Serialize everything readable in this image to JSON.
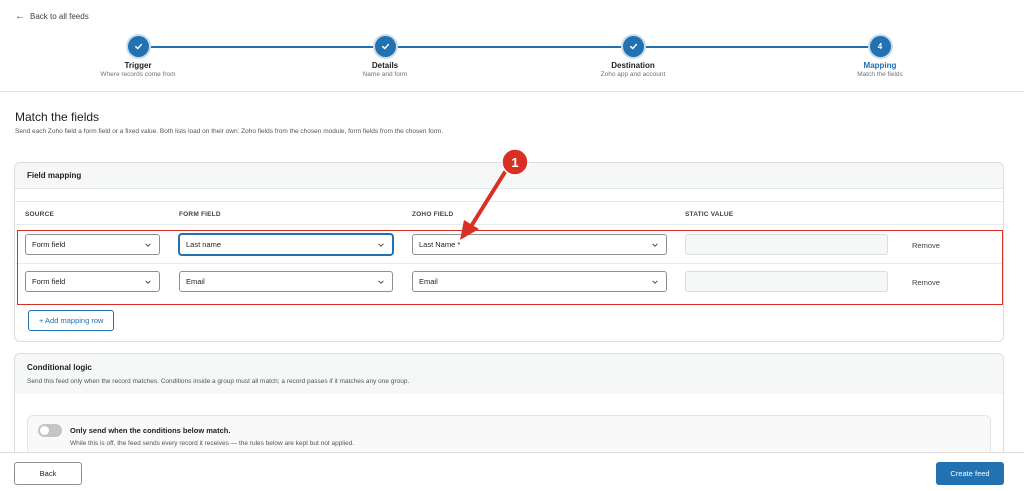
{
  "nav": {
    "back_label": "Back to all feeds"
  },
  "steps": [
    {
      "title": "Trigger",
      "subtitle": "Where records come from",
      "marker": "check"
    },
    {
      "title": "Details",
      "subtitle": "Name and form",
      "marker": "check"
    },
    {
      "title": "Destination",
      "subtitle": "Zoho app and account",
      "marker": "check"
    },
    {
      "title": "Mapping",
      "subtitle": "Match the fields",
      "marker": "4"
    }
  ],
  "page": {
    "title": "Match the fields",
    "description": "Send each Zoho field a form field or a fixed value. Both lists load on their own: Zoho fields from the chosen module, form fields from the chosen form."
  },
  "mapping": {
    "card_title": "Field mapping",
    "columns": {
      "source": "SOURCE",
      "form_field": "FORM FIELD",
      "zoho_field": "ZOHO FIELD",
      "static_value": "STATIC VALUE"
    },
    "rows": [
      {
        "source": "Form field",
        "form_field": "Last name",
        "zoho_field": "Last Name *",
        "static_value": "",
        "remove_label": "Remove"
      },
      {
        "source": "Form field",
        "form_field": "Email",
        "zoho_field": "Email",
        "static_value": "",
        "remove_label": "Remove"
      }
    ],
    "add_row_label": "+ Add mapping row"
  },
  "conditional": {
    "title": "Conditional logic",
    "description": "Send this feed only when the record matches. Conditions inside a group must all match; a record passes if it matches any one group.",
    "toggle_label": "Only send when the conditions below match.",
    "toggle_state": "off",
    "toggle_help": "While this is off, the feed sends every record it receives — the rules below are kept but not applied."
  },
  "footer": {
    "back_label": "Back",
    "create_label": "Create feed"
  },
  "annotation": {
    "marker_number": "1",
    "color": "#d93025"
  },
  "colors": {
    "accent": "#2271b1",
    "annotation": "#d93025"
  }
}
